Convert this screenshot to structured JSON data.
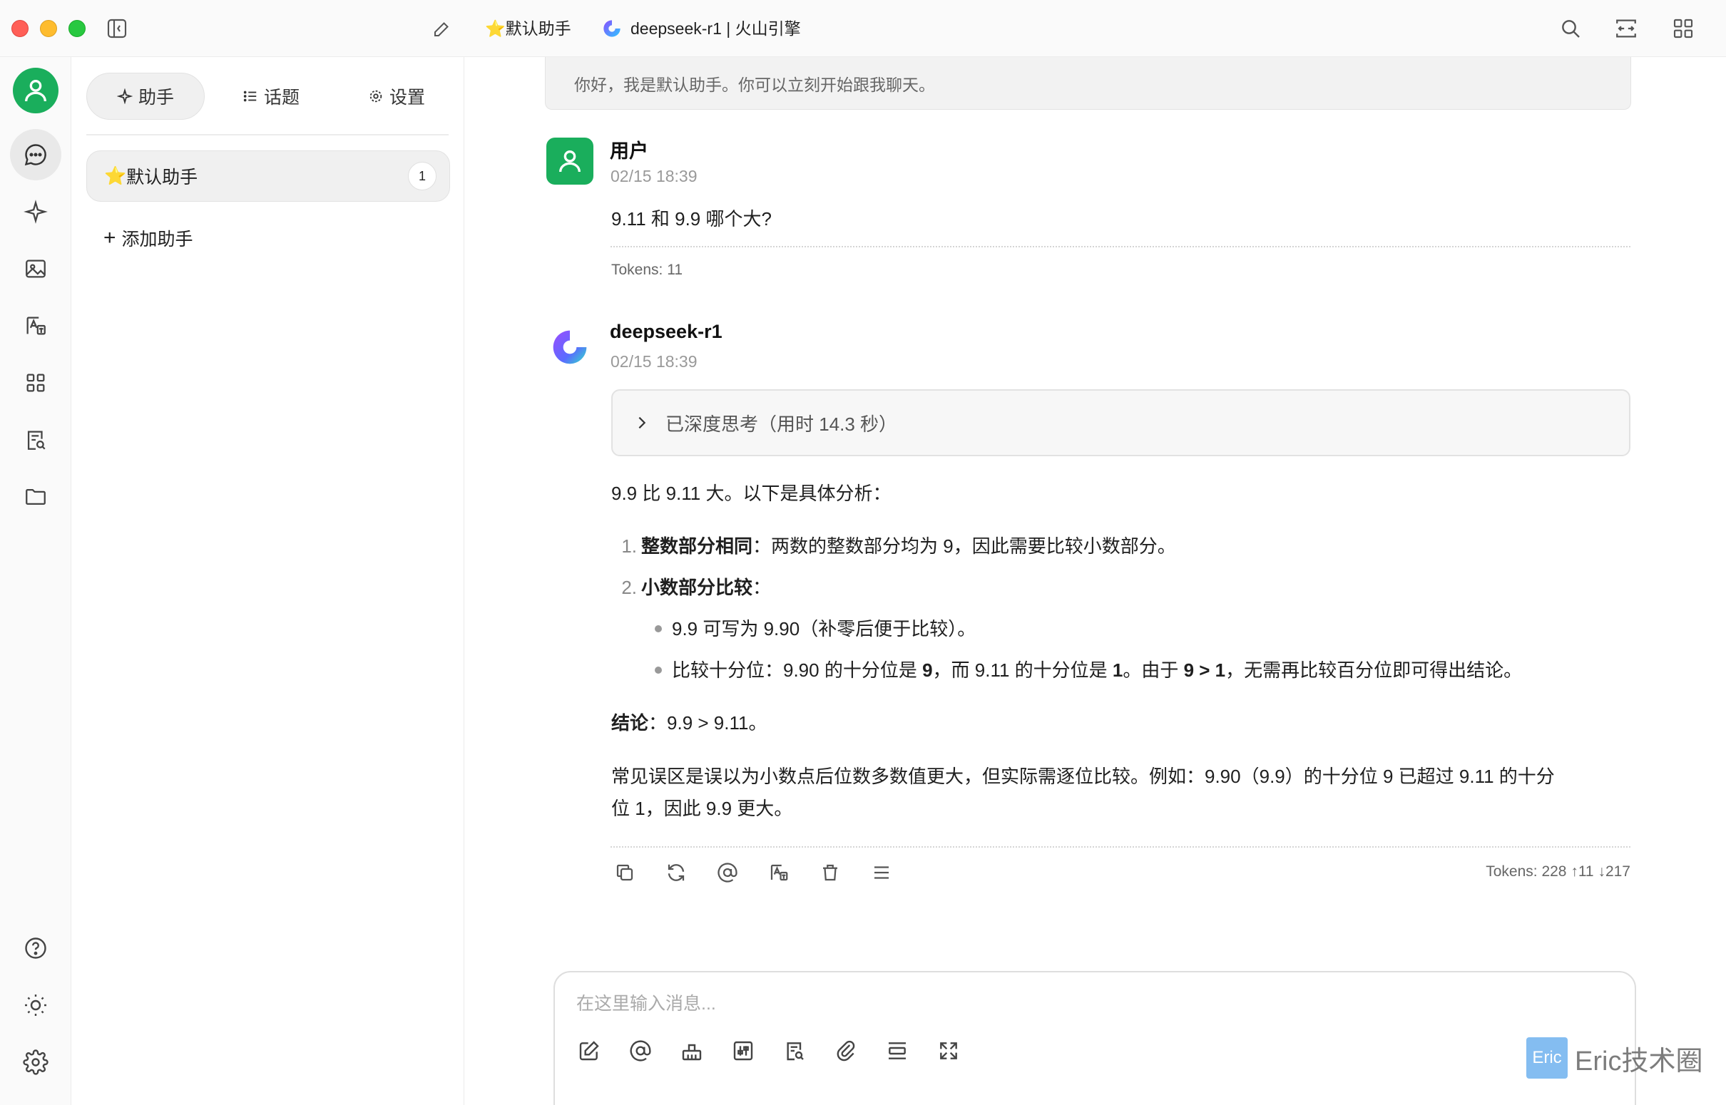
{
  "titlebar": {
    "assistant_title": "默认助手",
    "model_title": "deepseek-r1 | 火山引擎"
  },
  "panel": {
    "tabs": [
      {
        "label": "助手"
      },
      {
        "label": "话题"
      },
      {
        "label": "设置"
      }
    ],
    "assistant": {
      "name": "默认助手",
      "count": "1"
    },
    "add_label": "添加助手"
  },
  "chat": {
    "system_prompt": "你好，我是默认助手。你可以立刻开始跟我聊天。",
    "user": {
      "name": "用户",
      "time": "02/15 18:39",
      "text": "9.11 和 9.9 哪个大?",
      "tokens": "Tokens: 11"
    },
    "assistant": {
      "name": "deepseek-r1",
      "time": "02/15 18:39",
      "thinking": "已深度思考（用时 14.3 秒）",
      "intro": "9.9 比 9.11 大。以下是具体分析：",
      "item1_num": "1.",
      "item1_bold": "整数部分相同",
      "item1_text": "：两数的整数部分均为 9，因此需要比较小数部分。",
      "item2_num": "2.",
      "item2_bold": "小数部分比较",
      "item2_text": "：",
      "bullet1": "9.9 可写为 9.90（补零后便于比较）。",
      "bullet2_a": "比较十分位：9.90 的十分位是 ",
      "bullet2_b": "9",
      "bullet2_c": "，而 9.11 的十分位是 ",
      "bullet2_d": "1",
      "bullet2_e": "。由于 ",
      "bullet2_f": "9 > 1",
      "bullet2_g": "，无需再比较百分位即可得出结论。",
      "conclusion_bold": "结论",
      "conclusion_text": "：9.9 > 9.11。",
      "note_line1": "常见误区是误以为小数点后位数多数值更大，但实际需逐位比较。例如：9.90（9.9）的十分位 9 已超过 9.11 的十分",
      "note_line2": "位 1，因此 9.9 更大。",
      "tokens": "Tokens: 228 ↑11 ↓217"
    }
  },
  "input": {
    "placeholder": "在这里输入消息..."
  },
  "watermark": {
    "box_text": "Eric",
    "text": "Eric技术圈"
  },
  "colors": {
    "accent_green": "#1aae5c",
    "deepseek_purple": "#7b5cff"
  },
  "icons": {
    "sidebar_toggle": "sidebar-toggle-icon",
    "new_topic": "edit-icon",
    "search": "search-icon",
    "fullscreen": "expand-icon",
    "apps": "grid-icon"
  }
}
